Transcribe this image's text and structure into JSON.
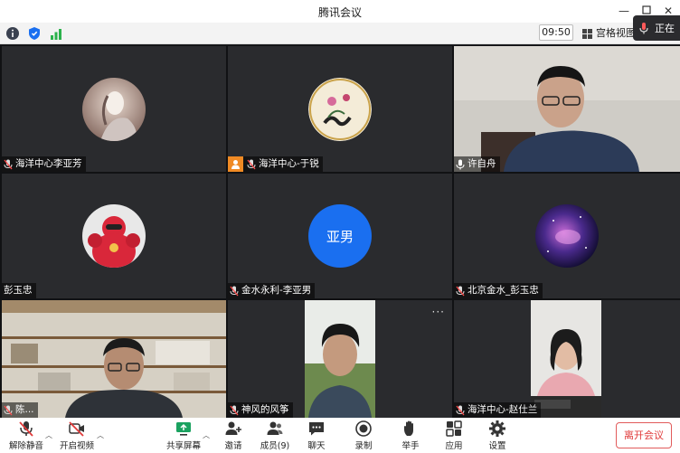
{
  "window": {
    "title": "腾讯会议"
  },
  "infobar": {
    "time": "09:50",
    "grid_view_label": "宫格视图",
    "speaking_label": "正在"
  },
  "tiles": [
    {
      "name": "海洋中心李亚芳"
    },
    {
      "name": "海洋中心-于锐"
    },
    {
      "name": "许自舟"
    },
    {
      "name": "彭玉忠"
    },
    {
      "name": "金水永利-李亚男",
      "avatar_text": "亚男"
    },
    {
      "name": "北京金水_彭玉忠"
    },
    {
      "name": "陈..."
    },
    {
      "name": "神风的风筝"
    },
    {
      "name": "海洋中心-赵仕兰"
    }
  ],
  "toolbar": {
    "mute": "解除静音",
    "video": "开启视频",
    "share": "共享屏幕",
    "invite": "邀请",
    "members": "成员(9)",
    "chat": "聊天",
    "record": "录制",
    "hand": "举手",
    "apps": "应用",
    "settings": "设置",
    "leave": "离开会议"
  },
  "colors": {
    "accent_blue": "#1a6ff0",
    "leave_red": "#e03a3a",
    "share_green": "#1aa260",
    "tile_bg": "#2a2b2e"
  }
}
